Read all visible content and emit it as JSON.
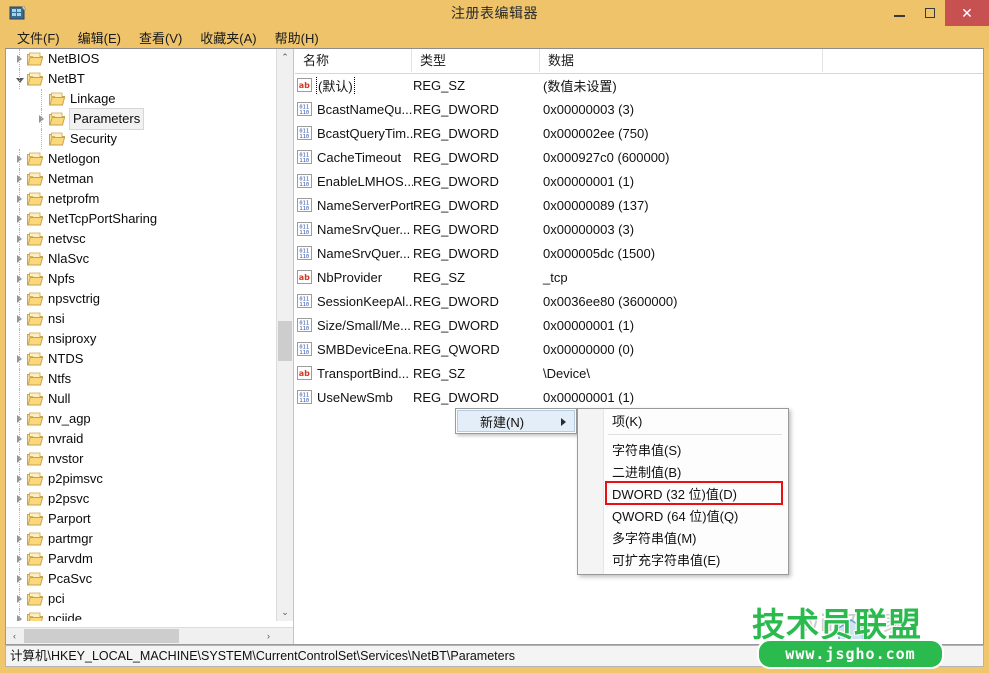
{
  "window": {
    "title": "注册表编辑器",
    "icon": "registry-editor-icon",
    "minimize": "–",
    "maximize": "□",
    "close": "✕",
    "accent_color": "#eec36a",
    "close_color": "#c75050"
  },
  "menubar": {
    "items": [
      {
        "label": "文件(F)"
      },
      {
        "label": "编辑(E)"
      },
      {
        "label": "查看(V)"
      },
      {
        "label": "收藏夹(A)"
      },
      {
        "label": "帮助(H)"
      }
    ]
  },
  "tree": {
    "nodes": [
      {
        "label": "NetBIOS",
        "depth": 1,
        "expander": "collapsed",
        "selected": false
      },
      {
        "label": "NetBT",
        "depth": 1,
        "expander": "expanded",
        "selected": false
      },
      {
        "label": "Linkage",
        "depth": 2,
        "expander": "none",
        "selected": false
      },
      {
        "label": "Parameters",
        "depth": 2,
        "expander": "collapsed",
        "selected": true
      },
      {
        "label": "Security",
        "depth": 2,
        "expander": "none",
        "selected": false
      },
      {
        "label": "Netlogon",
        "depth": 1,
        "expander": "collapsed",
        "selected": false
      },
      {
        "label": "Netman",
        "depth": 1,
        "expander": "collapsed",
        "selected": false
      },
      {
        "label": "netprofm",
        "depth": 1,
        "expander": "collapsed",
        "selected": false
      },
      {
        "label": "NetTcpPortSharing",
        "depth": 1,
        "expander": "collapsed",
        "selected": false
      },
      {
        "label": "netvsc",
        "depth": 1,
        "expander": "collapsed",
        "selected": false
      },
      {
        "label": "NlaSvc",
        "depth": 1,
        "expander": "collapsed",
        "selected": false
      },
      {
        "label": "Npfs",
        "depth": 1,
        "expander": "collapsed",
        "selected": false
      },
      {
        "label": "npsvctrig",
        "depth": 1,
        "expander": "collapsed",
        "selected": false
      },
      {
        "label": "nsi",
        "depth": 1,
        "expander": "collapsed",
        "selected": false
      },
      {
        "label": "nsiproxy",
        "depth": 1,
        "expander": "none",
        "selected": false
      },
      {
        "label": "NTDS",
        "depth": 1,
        "expander": "collapsed",
        "selected": false
      },
      {
        "label": "Ntfs",
        "depth": 1,
        "expander": "none",
        "selected": false
      },
      {
        "label": "Null",
        "depth": 1,
        "expander": "none",
        "selected": false
      },
      {
        "label": "nv_agp",
        "depth": 1,
        "expander": "collapsed",
        "selected": false
      },
      {
        "label": "nvraid",
        "depth": 1,
        "expander": "collapsed",
        "selected": false
      },
      {
        "label": "nvstor",
        "depth": 1,
        "expander": "collapsed",
        "selected": false
      },
      {
        "label": "p2pimsvc",
        "depth": 1,
        "expander": "collapsed",
        "selected": false
      },
      {
        "label": "p2psvc",
        "depth": 1,
        "expander": "collapsed",
        "selected": false
      },
      {
        "label": "Parport",
        "depth": 1,
        "expander": "none",
        "selected": false
      },
      {
        "label": "partmgr",
        "depth": 1,
        "expander": "collapsed",
        "selected": false
      },
      {
        "label": "Parvdm",
        "depth": 1,
        "expander": "collapsed",
        "selected": false
      },
      {
        "label": "PcaSvc",
        "depth": 1,
        "expander": "collapsed",
        "selected": false
      },
      {
        "label": "pci",
        "depth": 1,
        "expander": "collapsed",
        "selected": false
      },
      {
        "label": "pciide",
        "depth": 1,
        "expander": "collapsed",
        "selected": false
      }
    ],
    "scroll_up": "⌃",
    "scroll_down": "⌄",
    "scroll_left": "‹",
    "scroll_right": "›"
  },
  "list": {
    "columns": [
      "名称",
      "类型",
      "数据"
    ],
    "rows": [
      {
        "name": "(默认)",
        "icon": "string-value-icon",
        "type": "REG_SZ",
        "data": "(数值未设置)",
        "focused": true
      },
      {
        "name": "BcastNameQu...",
        "icon": "binary-value-icon",
        "type": "REG_DWORD",
        "data": "0x00000003 (3)",
        "focused": false
      },
      {
        "name": "BcastQueryTim...",
        "icon": "binary-value-icon",
        "type": "REG_DWORD",
        "data": "0x000002ee (750)",
        "focused": false
      },
      {
        "name": "CacheTimeout",
        "icon": "binary-value-icon",
        "type": "REG_DWORD",
        "data": "0x000927c0 (600000)",
        "focused": false
      },
      {
        "name": "EnableLMHOS...",
        "icon": "binary-value-icon",
        "type": "REG_DWORD",
        "data": "0x00000001 (1)",
        "focused": false
      },
      {
        "name": "NameServerPort",
        "icon": "binary-value-icon",
        "type": "REG_DWORD",
        "data": "0x00000089 (137)",
        "focused": false
      },
      {
        "name": "NameSrvQuer...",
        "icon": "binary-value-icon",
        "type": "REG_DWORD",
        "data": "0x00000003 (3)",
        "focused": false
      },
      {
        "name": "NameSrvQuer...",
        "icon": "binary-value-icon",
        "type": "REG_DWORD",
        "data": "0x000005dc (1500)",
        "focused": false
      },
      {
        "name": "NbProvider",
        "icon": "string-value-icon",
        "type": "REG_SZ",
        "data": "_tcp",
        "focused": false
      },
      {
        "name": "SessionKeepAl...",
        "icon": "binary-value-icon",
        "type": "REG_DWORD",
        "data": "0x0036ee80 (3600000)",
        "focused": false
      },
      {
        "name": "Size/Small/Me...",
        "icon": "binary-value-icon",
        "type": "REG_DWORD",
        "data": "0x00000001 (1)",
        "focused": false
      },
      {
        "name": "SMBDeviceEna...",
        "icon": "binary-value-icon",
        "type": "REG_QWORD",
        "data": "0x00000000 (0)",
        "focused": false
      },
      {
        "name": "TransportBind...",
        "icon": "string-value-icon",
        "type": "REG_SZ",
        "data": "\\Device\\",
        "focused": false
      },
      {
        "name": "UseNewSmb",
        "icon": "binary-value-icon",
        "type": "REG_DWORD",
        "data": "0x00000001 (1)",
        "focused": false
      }
    ]
  },
  "context_menu": {
    "parent_item": {
      "label": "新建(N)",
      "has_submenu": true,
      "highlighted": true
    },
    "submenu_items": [
      {
        "label": "项(K)",
        "highlighted": false,
        "separator_after": true
      },
      {
        "label": "字符串值(S)",
        "highlighted": false,
        "separator_after": false
      },
      {
        "label": "二进制值(B)",
        "highlighted": false,
        "separator_after": false
      },
      {
        "label": "DWORD (32 位)值(D)",
        "highlighted": true,
        "separator_after": false
      },
      {
        "label": "QWORD (64 位)值(Q)",
        "highlighted": false,
        "separator_after": false
      },
      {
        "label": "多字符串值(M)",
        "highlighted": false,
        "separator_after": false
      },
      {
        "label": "可扩充字符串值(E)",
        "highlighted": false,
        "separator_after": false
      }
    ],
    "highlight_color": "#e81010"
  },
  "statusbar": {
    "path": "计算机\\HKEY_LOCAL_MACHINE\\SYSTEM\\CurrentControlSet\\Services\\NetBT\\Parameters"
  },
  "watermark": {
    "brand": "技术员联盟",
    "url": "www.jsgho.com",
    "ghost": "win7之家",
    "brand_color": "#2aba4e"
  }
}
